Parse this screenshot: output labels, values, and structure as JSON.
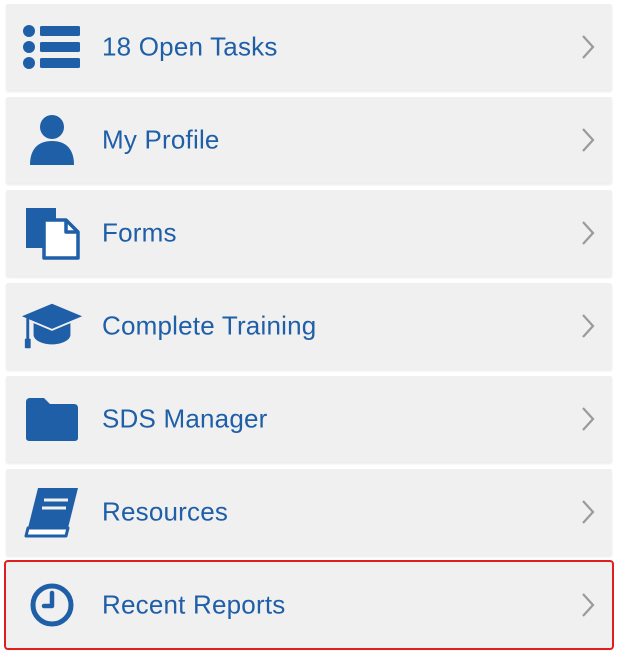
{
  "theme": {
    "accent": "#1f5fa8",
    "item_background": "#f0f0f0",
    "highlight_border": "#e01e1e",
    "chevron": "#9a9a9a"
  },
  "menu": {
    "items": [
      {
        "label": "18 Open Tasks",
        "icon": "list-icon"
      },
      {
        "label": "My Profile",
        "icon": "user-icon"
      },
      {
        "label": "Forms",
        "icon": "documents-icon"
      },
      {
        "label": "Complete Training",
        "icon": "graduation-cap-icon"
      },
      {
        "label": "SDS Manager",
        "icon": "folder-icon"
      },
      {
        "label": "Resources",
        "icon": "book-icon"
      },
      {
        "label": "Recent Reports",
        "icon": "clock-icon",
        "highlighted": true
      }
    ]
  }
}
